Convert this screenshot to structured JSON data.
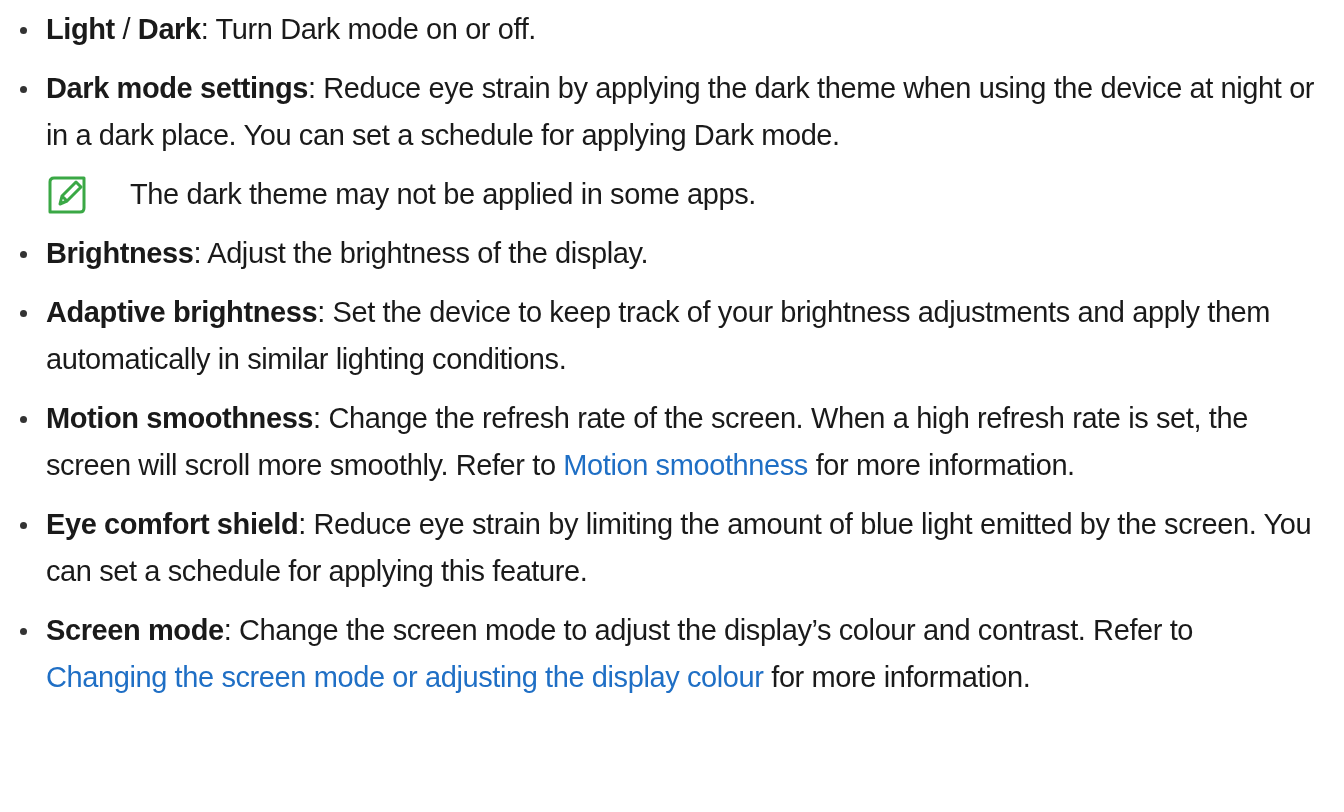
{
  "items": [
    {
      "segments": [
        {
          "kind": "text",
          "text": "**Light** / **Dark**: Turn Dark mode on or off."
        }
      ]
    },
    {
      "segments": [
        {
          "kind": "text",
          "text": "**Dark mode settings**: Reduce eye strain by applying the dark theme when using the device at night or in a dark place. You can set a schedule for applying Dark mode."
        }
      ],
      "note": "The dark theme may not be applied in some apps."
    },
    {
      "segments": [
        {
          "kind": "text",
          "text": "**Brightness**: Adjust the brightness of the display."
        }
      ]
    },
    {
      "segments": [
        {
          "kind": "text",
          "text": "**Adaptive brightness**: Set the device to keep track of your brightness adjustments and apply them automatically in similar lighting conditions."
        }
      ]
    },
    {
      "segments": [
        {
          "kind": "text",
          "text": "**Motion smoothness**: Change the refresh rate of the screen. When a high refresh rate is set, the screen will scroll more smoothly. Refer to "
        },
        {
          "kind": "link",
          "text": "Motion smoothness"
        },
        {
          "kind": "text",
          "text": " for more information."
        }
      ]
    },
    {
      "segments": [
        {
          "kind": "text",
          "text": "**Eye comfort shield**: Reduce eye strain by limiting the amount of blue light emitted by the screen. You can set a schedule for applying this feature."
        }
      ]
    },
    {
      "segments": [
        {
          "kind": "text",
          "text": "**Screen mode**: Change the screen mode to adjust the display’s colour and contrast. Refer to "
        },
        {
          "kind": "link",
          "text": "Changing the screen mode or adjusting the display colour"
        },
        {
          "kind": "text",
          "text": " for more information."
        }
      ]
    }
  ]
}
